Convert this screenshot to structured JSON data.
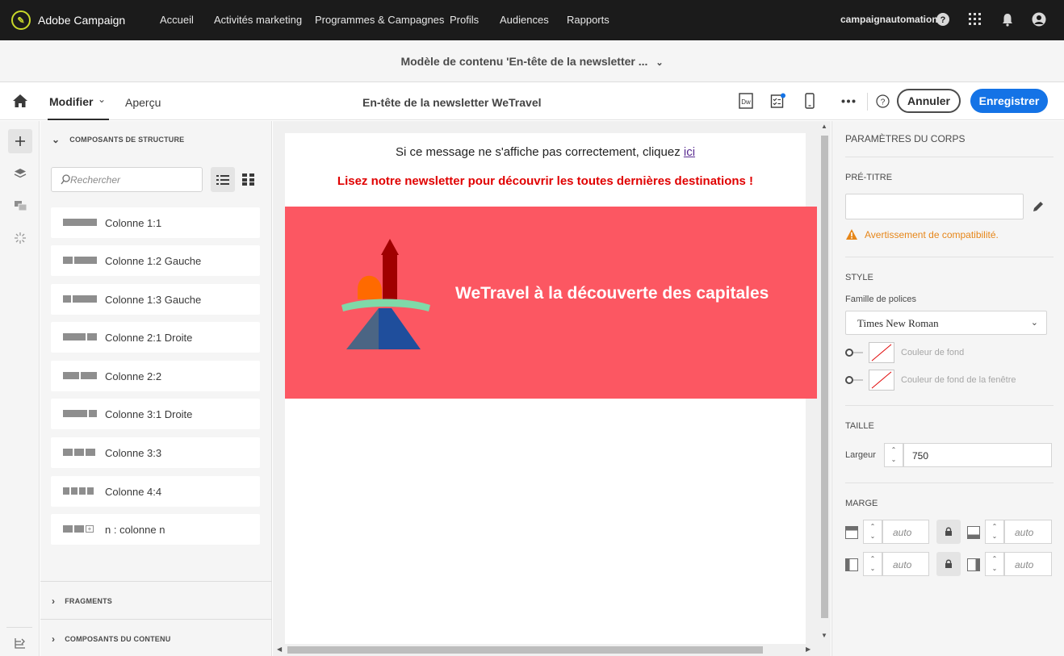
{
  "app": {
    "name": "Adobe Campaign"
  },
  "nav": {
    "items": [
      "Accueil",
      "Activités marketing",
      "Programmes & Campagnes",
      "Profils",
      "Audiences",
      "Rapports"
    ],
    "user": "campaignautomation"
  },
  "subheader": {
    "title": "Modèle de contenu 'En-tête de la newsletter ..."
  },
  "toolbar": {
    "tab_modifier": "Modifier",
    "tab_apercu": "Aperçu",
    "doc_title": "En-tête de la newsletter WeTravel",
    "dw_label": "Dw",
    "cancel_label": "Annuler",
    "save_label": "Enregistrer"
  },
  "components_panel": {
    "structure_title": "COMPOSANTS DE STRUCTURE",
    "search_placeholder": "Rechercher",
    "items": [
      "Colonne 1:1",
      "Colonne 1:2 Gauche",
      "Colonne 1:3 Gauche",
      "Colonne 2:1 Droite",
      "Colonne 2:2",
      "Colonne 3:1 Droite",
      "Colonne 3:3",
      "Colonne 4:4",
      "n : colonne n"
    ],
    "fragments_title": "FRAGMENTS",
    "content_title": "COMPOSANTS DU CONTENU"
  },
  "email": {
    "preheader_text": "Si ce message ne s'affiche pas correctement, cliquez ",
    "preheader_link": "ici",
    "promo_text": "Lisez notre newsletter pour découvrir les toutes dernières destinations !",
    "banner_title": "WeTravel à la découverte des capitales",
    "banner_color": "#fc5762"
  },
  "properties": {
    "title": "PARAMÈTRES DU CORPS",
    "pretitle_label": "PRÉ-TITRE",
    "pretitle_value": "",
    "warning": "Avertissement de compatibilité.",
    "style_label": "STYLE",
    "font_family_label": "Famille de polices",
    "font_family_value": "Times New Roman",
    "bg_color_label": "Couleur de fond",
    "window_bg_color_label": "Couleur de fond de la fenêtre",
    "size_label": "TAILLE",
    "width_label": "Largeur",
    "width_value": "750",
    "margin_label": "MARGE",
    "margin_placeholder": "auto"
  },
  "colors": {
    "accent": "#1473e6",
    "warning": "#e68619",
    "promo_red": "#e00000"
  }
}
